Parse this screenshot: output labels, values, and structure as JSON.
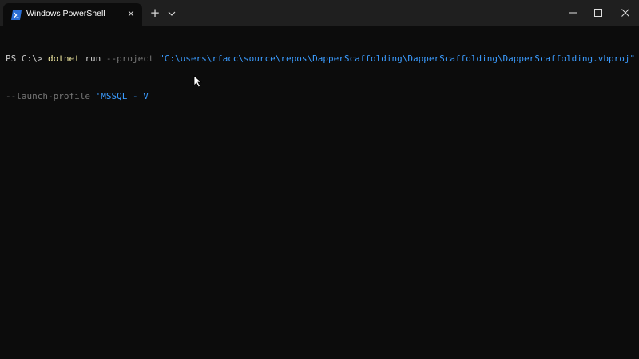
{
  "window": {
    "tab_title": "Windows PowerShell",
    "tab_close_glyph": "✕",
    "new_tab_glyph": "+",
    "icons": {
      "tab_icon": "powershell-icon",
      "dropdown": "chevron-down-icon",
      "minimize": "minimize-icon",
      "maximize": "maximize-icon",
      "close": "close-icon"
    }
  },
  "terminal": {
    "line1": {
      "prompt": "PS C:\\> ",
      "command": "dotnet",
      "arg1": " run ",
      "param1": "--project",
      "space": " ",
      "value1": "\"C:\\users\\rfacc\\source\\repos\\DapperScaffolding\\DapperScaffolding\\DapperScaffolding.vbproj\""
    },
    "line2": {
      "param2": "--launch-profile",
      "space": " ",
      "value2": "'MSSQL - V"
    }
  },
  "colors": {
    "background": "#0c0c0c",
    "titlebar": "#1f1f1f",
    "command": "#f9f1a5",
    "parameter": "#767676",
    "string": "#3b9cff",
    "text": "#cccccc"
  }
}
